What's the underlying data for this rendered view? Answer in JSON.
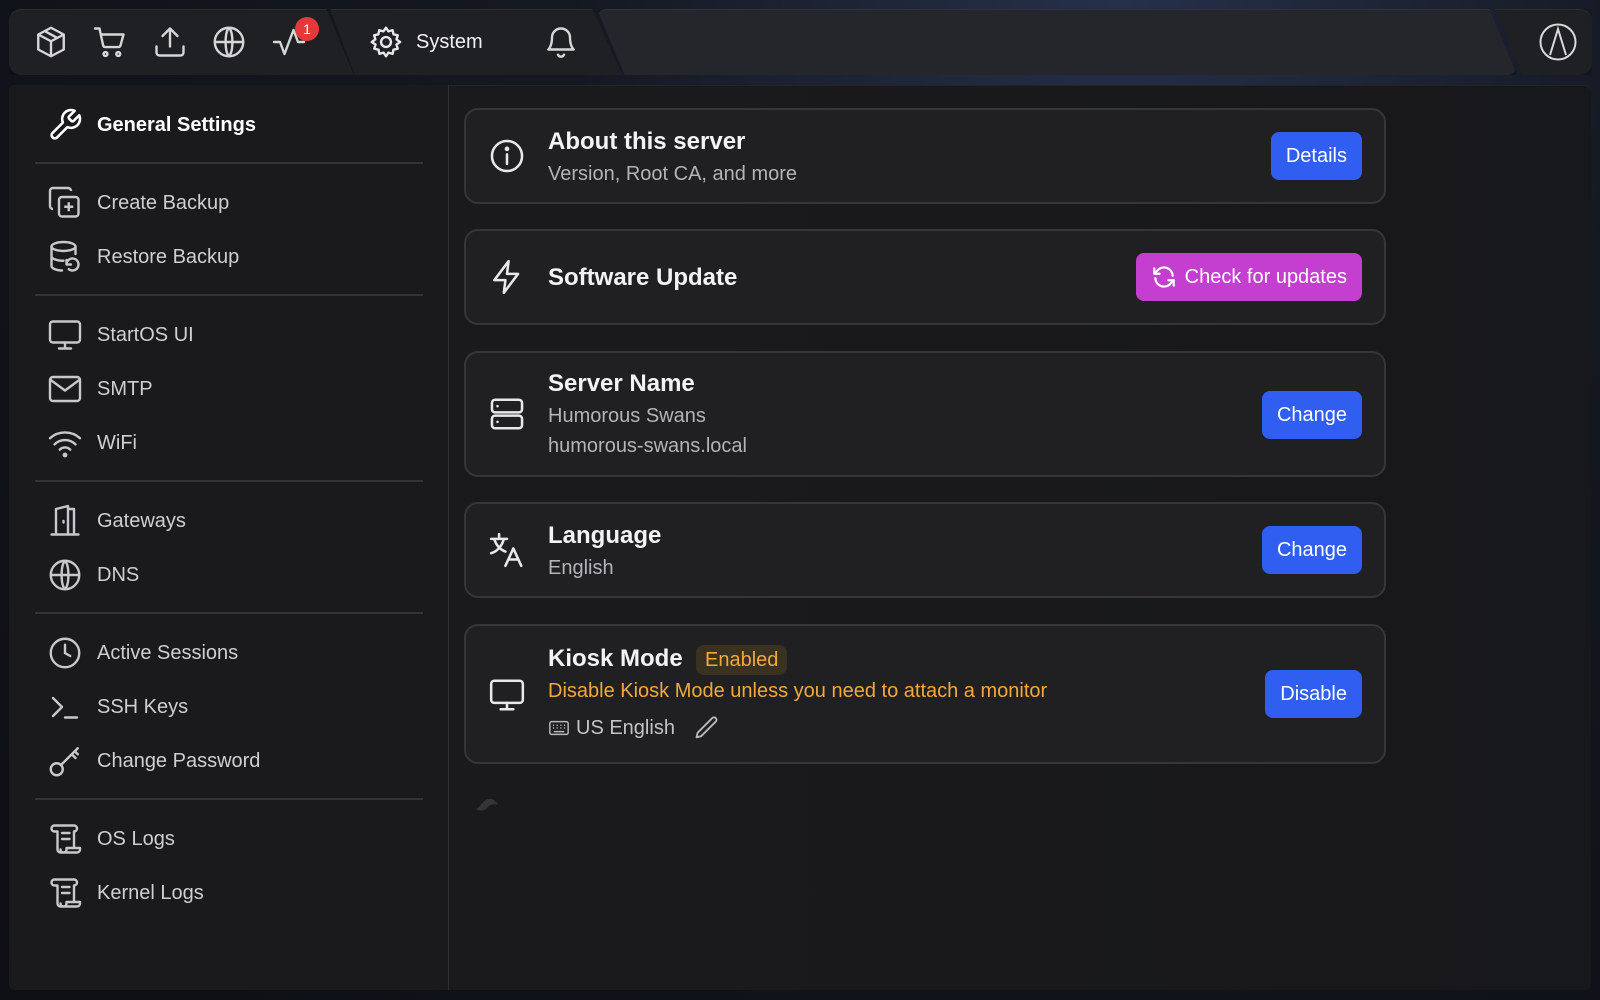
{
  "topbar": {
    "icons": [
      "package-icon",
      "cart-icon",
      "upload-icon",
      "globe-icon",
      "activity-icon"
    ],
    "notification_count": "1",
    "system_tab_label": "System",
    "bell_icon": "bell-icon",
    "logo_icon": "startos-logo-icon"
  },
  "sidebar": {
    "groups": [
      [
        {
          "label": "General Settings",
          "icon": "wrench-icon",
          "active": true
        }
      ],
      [
        {
          "label": "Create Backup",
          "icon": "copy-plus-icon"
        },
        {
          "label": "Restore Backup",
          "icon": "database-restore-icon"
        }
      ],
      [
        {
          "label": "StartOS UI",
          "icon": "monitor-icon"
        },
        {
          "label": "SMTP",
          "icon": "mail-icon"
        },
        {
          "label": "WiFi",
          "icon": "wifi-icon"
        }
      ],
      [
        {
          "label": "Gateways",
          "icon": "door-icon"
        },
        {
          "label": "DNS",
          "icon": "globe-icon"
        }
      ],
      [
        {
          "label": "Active Sessions",
          "icon": "clock-icon"
        },
        {
          "label": "SSH Keys",
          "icon": "terminal-icon"
        },
        {
          "label": "Change Password",
          "icon": "key-icon"
        }
      ],
      [
        {
          "label": "OS Logs",
          "icon": "scroll-icon"
        },
        {
          "label": "Kernel Logs",
          "icon": "scroll-icon"
        }
      ]
    ]
  },
  "cards": {
    "about": {
      "title": "About this server",
      "subtitle": "Version, Root CA, and more",
      "button": "Details",
      "icon": "info-icon"
    },
    "update": {
      "title": "Software Update",
      "button": "Check for updates",
      "icon": "zap-icon"
    },
    "server_name": {
      "title": "Server Name",
      "name": "Humorous Swans",
      "host": "humorous-swans.local",
      "button": "Change",
      "icon": "server-icon"
    },
    "language": {
      "title": "Language",
      "value": "English",
      "button": "Change",
      "icon": "translate-icon"
    },
    "kiosk": {
      "title": "Kiosk Mode",
      "status": "Enabled",
      "warning": "Disable Kiosk Mode unless you need to attach a monitor",
      "keyboard": "US English",
      "button": "Disable",
      "icon": "monitor-icon"
    }
  },
  "colors": {
    "accent_blue": "#2f5ef0",
    "accent_pink": "#c43ecf",
    "warning": "#f2a83b",
    "badge_red": "#e5383b"
  }
}
